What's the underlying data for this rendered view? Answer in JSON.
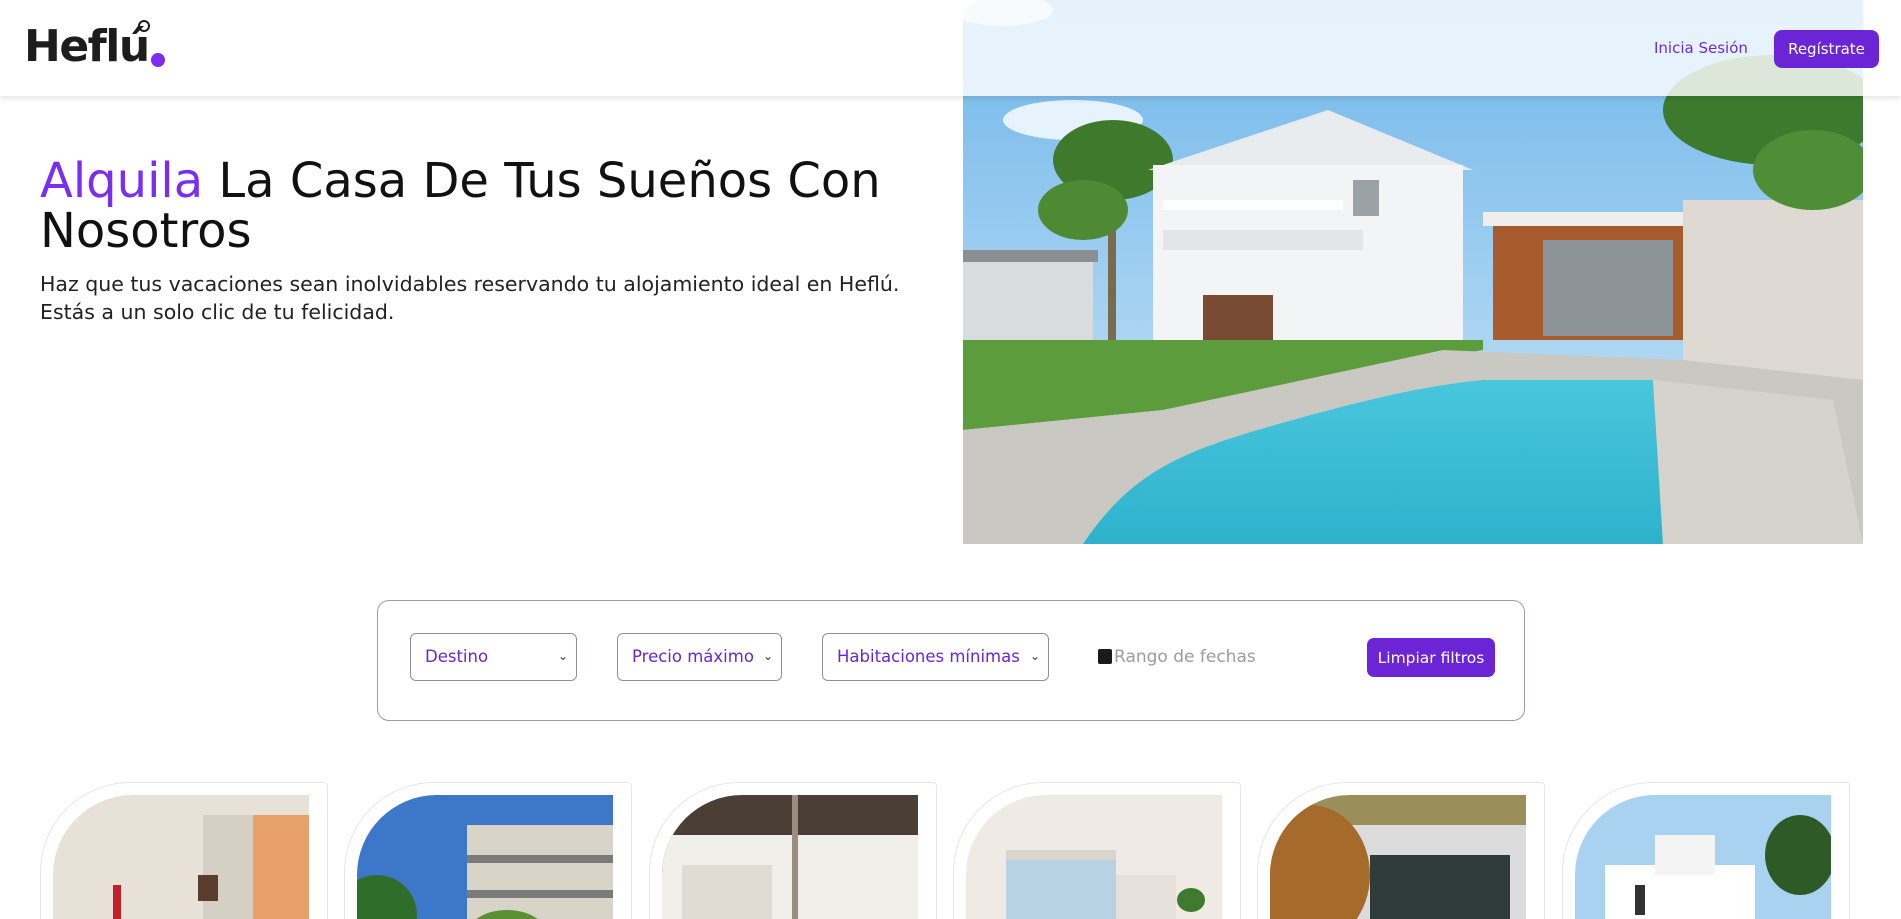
{
  "header": {
    "logo_text": "Heflú",
    "login_label": "Inicia Sesión",
    "register_label": "Regístrate"
  },
  "hero": {
    "title_accent": "Alquila",
    "title_rest": " La Casa De Tus Sueños Con Nosotros",
    "subtitle_line1": "Haz que tus vacaciones sean inolvidables reservando tu alojamiento ideal en Heflú.",
    "subtitle_line2": "Estás a un solo clic de tu felicidad."
  },
  "filters": {
    "destination": "Destino",
    "max_price": "Precio máximo",
    "min_rooms": "Habitaciones mínimas",
    "date_range_placeholder": "Rango de fechas",
    "clear_label": "Limpiar filtros"
  },
  "colors": {
    "brand": "#6b25d6",
    "accent": "#7a2ff0"
  },
  "icons": {
    "calendar": "calendar-icon",
    "chevron": "chevron-down-icon"
  }
}
